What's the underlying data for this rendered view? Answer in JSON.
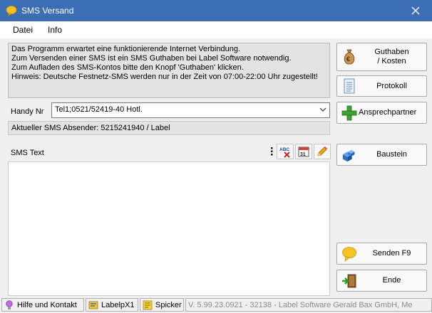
{
  "window": {
    "title": "SMS Versand",
    "close_symbol": "✕"
  },
  "menu": {
    "datei": "Datei",
    "info": "Info"
  },
  "info_lines": [
    "Das Programm erwartet eine funktionierende Internet Verbindung.",
    "Zum Versenden einer SMS ist ein SMS Guthaben bei Label Software notwendig.",
    "Zum Aufladen des SMS-Kontos bitte den Knopf 'Guthaben' klicken.",
    "Hinweis: Deutsche Festnetz-SMS werden nur in der Zeit von 07:00-22:00 Uhr zugestellt!"
  ],
  "handy": {
    "label": "Handy Nr",
    "value": "Tel1;0521/52419-40 Hotl.",
    "chevron": "⌄"
  },
  "sender": {
    "text": "Aktueller SMS Absender: 5215241940 / Label"
  },
  "sms_text": {
    "label": "SMS Text",
    "value": ""
  },
  "toolbar": {
    "calendar_day": "31"
  },
  "buttons": {
    "guthaben_line1": "Guthaben",
    "guthaben_line2": "/ Kosten",
    "protokoll": "Protokoll",
    "ansprechpartner": "Ansprechpartner",
    "baustein": "Baustein",
    "senden": "Senden F9",
    "ende": "Ende"
  },
  "statusbar": {
    "hilfe": "Hilfe und Kontakt",
    "labelpx": "LabelpX1",
    "spicker": "Spicker",
    "version": "V. 5.99.23.0921 - 32138 - Label Software Gerald Bax GmbH, Me"
  },
  "colors": {
    "titlebar": "#3c6eb4",
    "panel": "#e3e3e3",
    "background": "#f0f0f0"
  }
}
